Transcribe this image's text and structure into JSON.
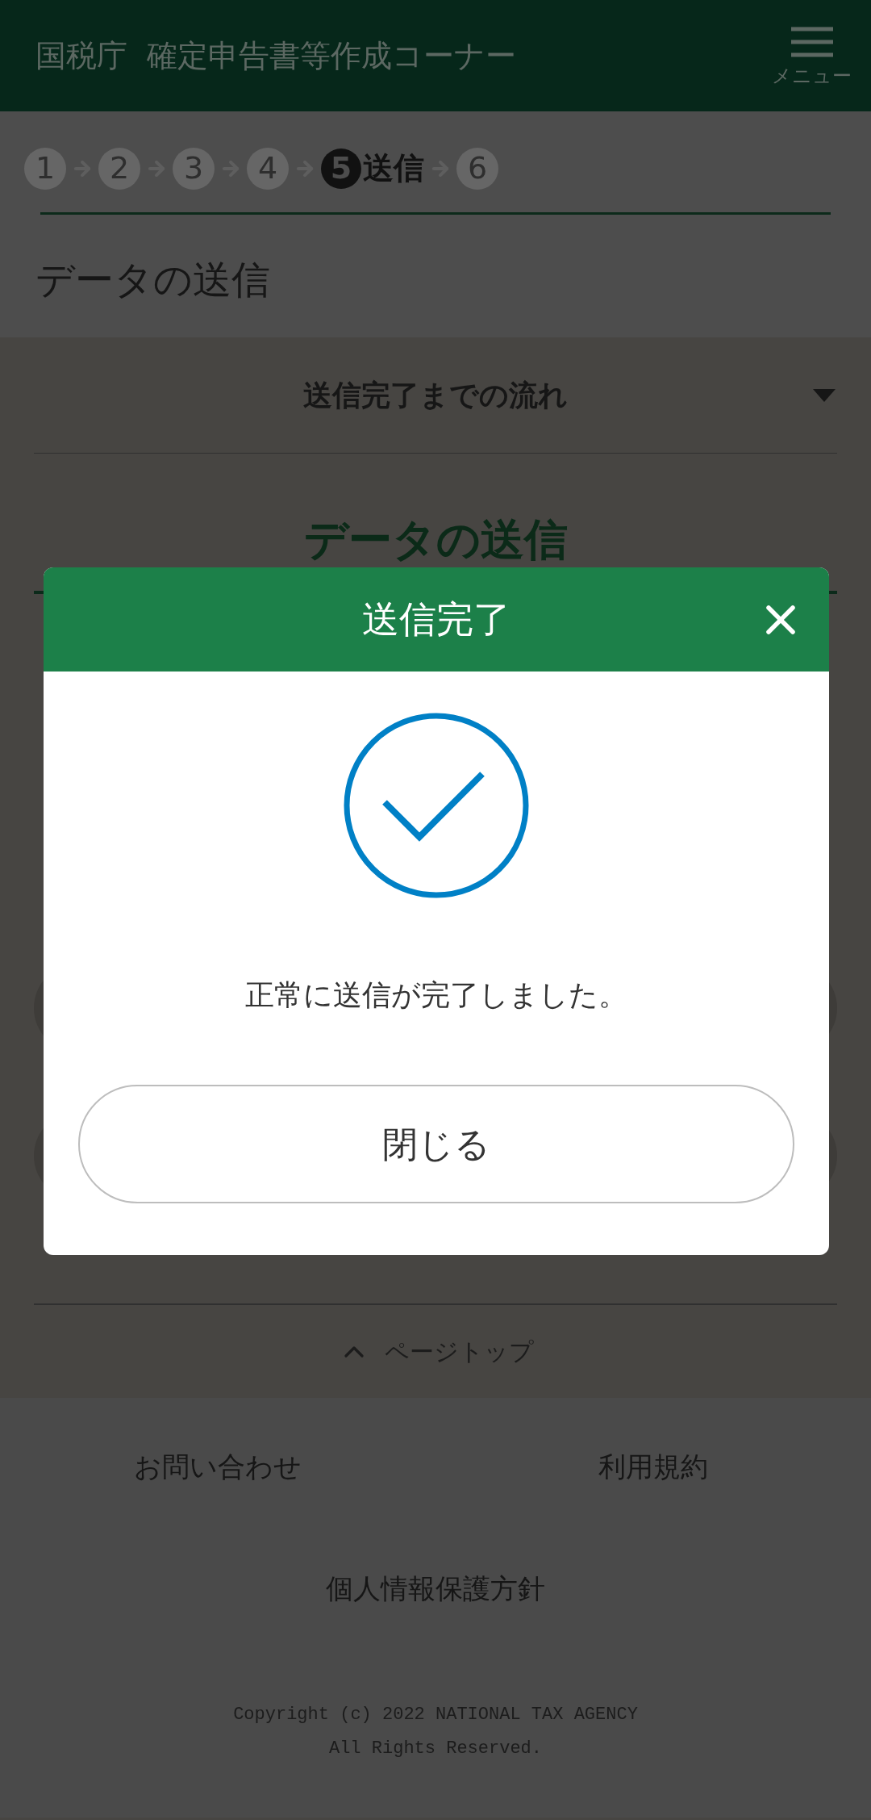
{
  "header": {
    "title": "国税庁  確定申告書等作成コーナー",
    "menu_label": "メニュー"
  },
  "steps": [
    {
      "number": "1",
      "selected": false
    },
    {
      "number": "2",
      "selected": false
    },
    {
      "number": "3",
      "selected": false
    },
    {
      "number": "4",
      "selected": false
    },
    {
      "number": "5",
      "label": "送信",
      "selected": true
    },
    {
      "number": "6",
      "selected": false
    }
  ],
  "page_title": "データの送信",
  "accordion": {
    "label": "送信完了までの流れ",
    "expanded": false
  },
  "section_heading": "データの送信",
  "page_top": "ページトップ",
  "footer": {
    "links": [
      "お問い合わせ",
      "利用規約",
      "個人情報保護方針"
    ],
    "copyright": [
      "Copyright (c) 2022 NATIONAL TAX AGENCY",
      "All Rights Reserved."
    ]
  },
  "dialog": {
    "title": "送信完了",
    "message": "正常に送信が完了しました。",
    "button": "閉じる"
  }
}
